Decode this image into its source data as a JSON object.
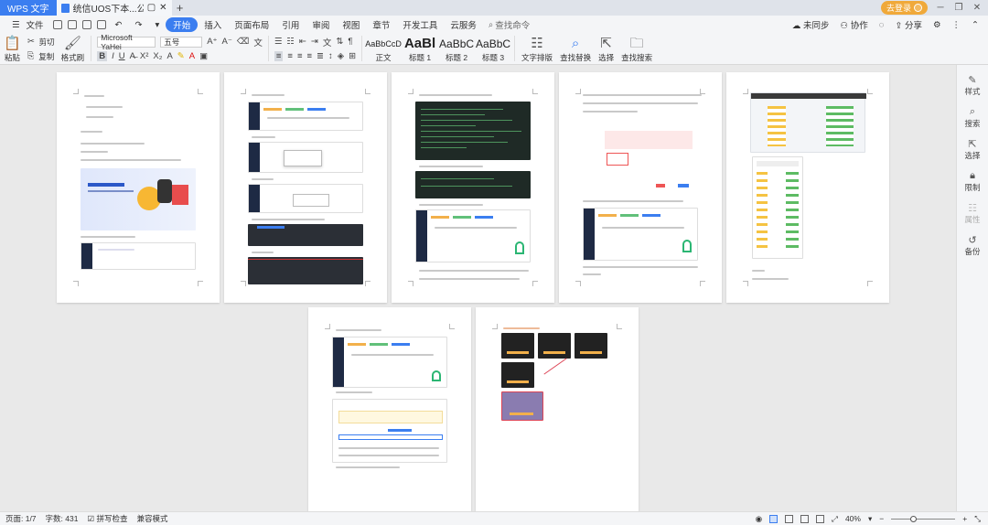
{
  "titlebar": {
    "app_tab": "WPS 文字",
    "doc_tab": "统信UOS下本...公网的操作方法",
    "login": "去登录"
  },
  "menubar": {
    "file": "文件",
    "items": [
      "开始",
      "插入",
      "页面布局",
      "引用",
      "审阅",
      "视图",
      "章节",
      "开发工具",
      "云服务"
    ],
    "search": "查找命令",
    "right": [
      "未同步",
      "协作",
      "分享"
    ]
  },
  "ribbon": {
    "paste": "粘贴",
    "cut": "剪切",
    "copy": "复制",
    "format_painter": "格式刷",
    "font_name": "Microsoft YaHei",
    "font_size": "五号",
    "styles": [
      {
        "sample": "AaBbCcD",
        "name": "正文"
      },
      {
        "sample": "AaBl",
        "name": "标题 1"
      },
      {
        "sample": "AaBbC",
        "name": "标题 2"
      },
      {
        "sample": "AaBbC",
        "name": "标题 3"
      }
    ],
    "text_layout": "文字排版",
    "find_replace": "查找替换",
    "select": "选择",
    "find_and_search": "查找搜索"
  },
  "sidebar": [
    {
      "label": "样式",
      "icon": "pen-icon",
      "enabled": true
    },
    {
      "label": "搜索",
      "icon": "search-icon",
      "enabled": true
    },
    {
      "label": "选择",
      "icon": "cursor-icon",
      "enabled": true
    },
    {
      "label": "限制",
      "icon": "lock-icon",
      "enabled": true
    },
    {
      "label": "属性",
      "icon": "properties-icon",
      "enabled": false
    },
    {
      "label": "备份",
      "icon": "backup-icon",
      "enabled": true
    }
  ],
  "statusbar": {
    "page": "页面: 1/7",
    "words": "字数: 431",
    "spell": "拼写检查",
    "compat": "兼容模式",
    "zoom": "40%",
    "zoom_value": 0.4
  }
}
